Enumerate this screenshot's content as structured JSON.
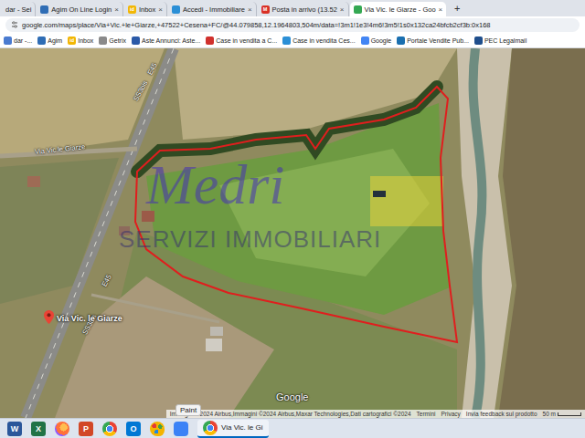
{
  "browser": {
    "tabs": [
      {
        "label": "dar - Sei",
        "selected": false,
        "color": "#4a7bd0",
        "icon_text": ""
      },
      {
        "label": "Agim On Line Login",
        "selected": false,
        "color": "#2f6db5",
        "icon_text": ""
      },
      {
        "label": "Inbox",
        "selected": false,
        "color": "#f2b705",
        "icon_text": "id"
      },
      {
        "label": "Accedi - Immobiliare",
        "selected": false,
        "color": "#2b8fd6",
        "icon_text": ""
      },
      {
        "label": "Posta in arrivo (13.52",
        "selected": false,
        "color": "#d93025",
        "icon_text": "M"
      },
      {
        "label": "Via Vic. le Giarze - Goo",
        "selected": true,
        "color": "#34a853",
        "icon_text": ""
      }
    ],
    "tab_close": "×",
    "new_tab": "+"
  },
  "address_bar": {
    "url": "google.com/maps/place/Via+Vic.+le+Giarze,+47522+Cesena+FC/@44.079858,12.1964803,504m/data=!3m1!1e3!4m6!3m5!1s0x132ca24bfcb2cf3b:0x168"
  },
  "bookmarks": [
    {
      "label": "dar -...",
      "color": "#4a7bd0",
      "icon_text": ""
    },
    {
      "label": "Agim",
      "color": "#2f6db5",
      "icon_text": ""
    },
    {
      "label": "Inbox",
      "color": "#f2b705",
      "icon_text": "id"
    },
    {
      "label": "Getrix",
      "color": "#8a8a8a",
      "icon_text": ""
    },
    {
      "label": "Aste Annunci: Aste...",
      "color": "#2b5aa8",
      "icon_text": ""
    },
    {
      "label": "Case in vendita a C...",
      "color": "#d0312d",
      "icon_text": ""
    },
    {
      "label": "Case in vendita Ces...",
      "color": "#2b8fd6",
      "icon_text": ""
    },
    {
      "label": "Google",
      "color": "#4285f4",
      "icon_text": ""
    },
    {
      "label": "Portale Vendite Pub...",
      "color": "#1a6fb0",
      "icon_text": ""
    },
    {
      "label": "PEC Legalmail",
      "color": "#1f4e8c",
      "icon_text": ""
    }
  ],
  "map": {
    "watermark": {
      "brand": "Medri",
      "subtitle": "SERVIZI IMMOBILIARI"
    },
    "road_labels": [
      {
        "label": "Via Vic.le Giarze"
      },
      {
        "label": "E45"
      },
      {
        "label": "SS3bis"
      },
      {
        "label": "E45"
      },
      {
        "label": "SS3bis"
      }
    ],
    "pin": {
      "label": "Via Vic. le Giarze"
    },
    "logo": "Google",
    "attribution": "Immagini ©2024 Airbus,Immagini ©2024 Airbus,Maxar Technologies,Dati cartografici ©2024",
    "footer_links": [
      "Termini",
      "Privacy",
      "Invia feedback sul prodotto"
    ],
    "scale": "50 m"
  },
  "taskbar": {
    "tooltip": "Paint",
    "apps": [
      {
        "kind": "letter",
        "letter": "W",
        "color": "#2b579a"
      },
      {
        "kind": "letter",
        "letter": "X",
        "color": "#217346"
      },
      {
        "kind": "firefox",
        "letter": "",
        "color": "#ff7139"
      },
      {
        "kind": "letter",
        "letter": "P",
        "color": "#d24726"
      },
      {
        "kind": "chrome",
        "letter": "",
        "color": "#34a853"
      },
      {
        "kind": "letter",
        "letter": "O",
        "color": "#0078d4"
      },
      {
        "kind": "paint",
        "letter": "",
        "color": "#f4b400"
      },
      {
        "kind": "media",
        "letter": "",
        "color": "#3b82f6"
      }
    ],
    "active_window": {
      "label": "Via Vic. le Gi"
    }
  }
}
